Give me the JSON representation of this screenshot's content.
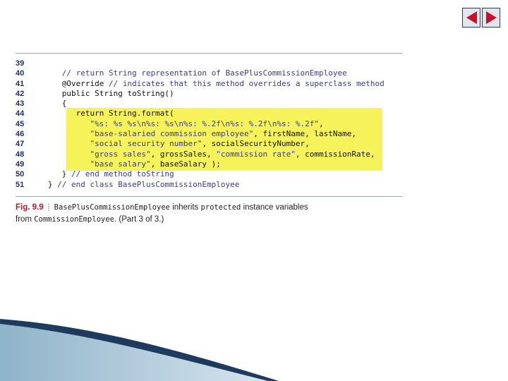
{
  "nav": {
    "prev": "previous-slide",
    "next": "next-slide"
  },
  "code": {
    "lines": [
      {
        "num": "39",
        "segments": []
      },
      {
        "num": "40",
        "segments": [
          {
            "t": "      ",
            "k": "p"
          },
          {
            "t": "// return String representation of BasePlusCommissionEmployee",
            "k": "comment"
          }
        ]
      },
      {
        "num": "41",
        "segments": [
          {
            "t": "      @Override ",
            "k": "p"
          },
          {
            "t": "// indicates that this method overrides a superclass method",
            "k": "comment"
          }
        ]
      },
      {
        "num": "42",
        "segments": [
          {
            "t": "      public String toString()",
            "k": "p"
          }
        ]
      },
      {
        "num": "43",
        "segments": [
          {
            "t": "      {",
            "k": "p"
          }
        ]
      },
      {
        "num": "44",
        "segments": [
          {
            "t": "         return String.format(",
            "k": "p"
          }
        ]
      },
      {
        "num": "45",
        "segments": [
          {
            "t": "            ",
            "k": "p"
          },
          {
            "t": "\"%s: %s %s\\n%s: %s\\n%s: %.2f\\n%s: %.2f\\n%s: %.2f\"",
            "k": "string"
          },
          {
            "t": ",",
            "k": "p"
          }
        ]
      },
      {
        "num": "46",
        "segments": [
          {
            "t": "            ",
            "k": "p"
          },
          {
            "t": "\"base-salaried commission employee\"",
            "k": "string"
          },
          {
            "t": ", firstName, lastName,",
            "k": "p"
          }
        ]
      },
      {
        "num": "47",
        "segments": [
          {
            "t": "            ",
            "k": "p"
          },
          {
            "t": "\"social security number\"",
            "k": "string"
          },
          {
            "t": ", socialSecurityNumber,",
            "k": "p"
          }
        ]
      },
      {
        "num": "48",
        "segments": [
          {
            "t": "            ",
            "k": "p"
          },
          {
            "t": "\"gross sales\"",
            "k": "string"
          },
          {
            "t": ", grossSales, ",
            "k": "p"
          },
          {
            "t": "\"commission rate\"",
            "k": "string"
          },
          {
            "t": ", commissionRate,",
            "k": "p"
          }
        ]
      },
      {
        "num": "49",
        "segments": [
          {
            "t": "            ",
            "k": "p"
          },
          {
            "t": "\"base salary\"",
            "k": "string"
          },
          {
            "t": ", baseSalary );",
            "k": "p"
          }
        ]
      },
      {
        "num": "50",
        "segments": [
          {
            "t": "      } ",
            "k": "p"
          },
          {
            "t": "// end method toString",
            "k": "comment"
          }
        ]
      },
      {
        "num": "51",
        "segments": [
          {
            "t": "   } ",
            "k": "p"
          },
          {
            "t": "// end class BasePlusCommissionEmployee",
            "k": "comment"
          }
        ]
      }
    ]
  },
  "caption": {
    "fig": "Fig. 9.9",
    "class_name": "BasePlusCommissionEmployee",
    "text1": " inherits ",
    "keyword": "protected",
    "text2": " instance variables",
    "text3": "from ",
    "class2": "CommissionEmployee",
    "text4": ". (Part 3 of 3.)"
  },
  "colors": {
    "accent_red": "#c8102e",
    "highlight": "#f6f25a",
    "line_number": "#1f2e60",
    "comment": "#3b3b8f",
    "swoosh": "#1e3a5f"
  }
}
